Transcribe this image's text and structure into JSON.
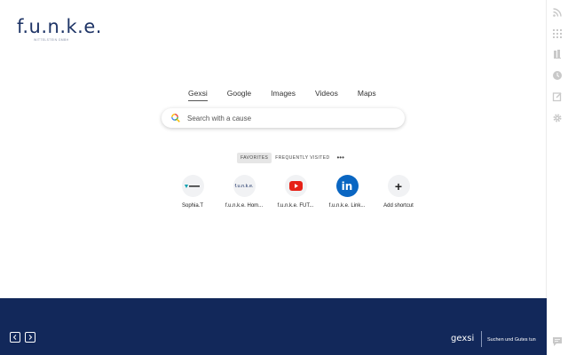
{
  "logo": {
    "name": "f.u.n.k.e.",
    "subtitle": "WITTELSTEIN GMBH"
  },
  "search_tabs": [
    {
      "label": "Gexsi",
      "active": true
    },
    {
      "label": "Google",
      "active": false
    },
    {
      "label": "Images",
      "active": false
    },
    {
      "label": "Videos",
      "active": false
    },
    {
      "label": "Maps",
      "active": false
    }
  ],
  "search": {
    "placeholder": "Search with a cause",
    "value": ""
  },
  "filters": {
    "favorites": "FAVORITES",
    "frequently_visited": "FREQUENTLY VISITED",
    "more": "•••"
  },
  "shortcuts": [
    {
      "label": "Sophia.T",
      "icon": "sophia-logo-icon"
    },
    {
      "label": "f.u.n.k.e. Hom...",
      "icon": "funke-logo-icon",
      "icon_text": "f.u.n.k.e."
    },
    {
      "label": "f.u.n.k.e. FUT...",
      "icon": "youtube-icon"
    },
    {
      "label": "f.u.n.k.e. Link...",
      "icon": "linkedin-icon",
      "icon_text": "in"
    },
    {
      "label": "Add shortcut",
      "icon": "plus-icon",
      "icon_text": "+"
    }
  ],
  "footer": {
    "brand": "gexsi",
    "tagline": "Suchen und Gutes tun"
  },
  "sidebar_icons": [
    "rss-icon",
    "apps-grid-icon",
    "bookmarks-icon",
    "history-icon",
    "notes-icon",
    "settings-icon"
  ],
  "colors": {
    "navy": "#12285a",
    "youtube_red": "#e62117",
    "linkedin_blue": "#0a66c2"
  }
}
